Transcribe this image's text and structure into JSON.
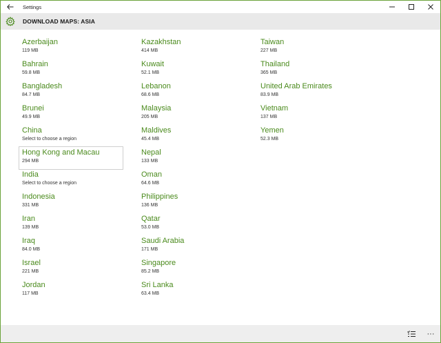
{
  "window": {
    "title": "Settings",
    "back_icon": "back-arrow-icon",
    "minimize_glyph": "—",
    "maximize_glyph": "☐",
    "close_glyph": "✕"
  },
  "header": {
    "title": "DOWNLOAD MAPS: ASIA",
    "icon": "gear-icon"
  },
  "accent_color": "#4a8a1c",
  "columns": [
    [
      {
        "name": "Azerbaijan",
        "size": "119 MB"
      },
      {
        "name": "Bahrain",
        "size": "59.8 MB"
      },
      {
        "name": "Bangladesh",
        "size": "84.7 MB"
      },
      {
        "name": "Brunei",
        "size": "49.9 MB"
      },
      {
        "name": "China",
        "size": "Select to choose a region"
      },
      {
        "name": "Hong Kong and Macau",
        "size": "294 MB",
        "selected": true
      },
      {
        "name": "India",
        "size": "Select to choose a region"
      },
      {
        "name": "Indonesia",
        "size": "331 MB"
      },
      {
        "name": "Iran",
        "size": "139 MB"
      },
      {
        "name": "Iraq",
        "size": "84.0 MB"
      },
      {
        "name": "Israel",
        "size": "221 MB"
      },
      {
        "name": "Jordan",
        "size": "117 MB"
      }
    ],
    [
      {
        "name": "Kazakhstan",
        "size": "414 MB"
      },
      {
        "name": "Kuwait",
        "size": "52.1 MB"
      },
      {
        "name": "Lebanon",
        "size": "68.6 MB"
      },
      {
        "name": "Malaysia",
        "size": "205 MB"
      },
      {
        "name": "Maldives",
        "size": "45.4 MB"
      },
      {
        "name": "Nepal",
        "size": "133 MB"
      },
      {
        "name": "Oman",
        "size": "64.6 MB"
      },
      {
        "name": "Philippines",
        "size": "136 MB"
      },
      {
        "name": "Qatar",
        "size": "53.0 MB"
      },
      {
        "name": "Saudi Arabia",
        "size": "171 MB"
      },
      {
        "name": "Singapore",
        "size": "85.2 MB"
      },
      {
        "name": "Sri Lanka",
        "size": "63.4 MB"
      }
    ],
    [
      {
        "name": "Taiwan",
        "size": "227 MB"
      },
      {
        "name": "Thailand",
        "size": "365 MB"
      },
      {
        "name": "United Arab Emirates",
        "size": "83.9 MB"
      },
      {
        "name": "Vietnam",
        "size": "137 MB"
      },
      {
        "name": "Yemen",
        "size": "52.3 MB"
      }
    ]
  ],
  "bottom_bar": {
    "select_icon": "select-list-icon",
    "more_glyph": "···"
  }
}
